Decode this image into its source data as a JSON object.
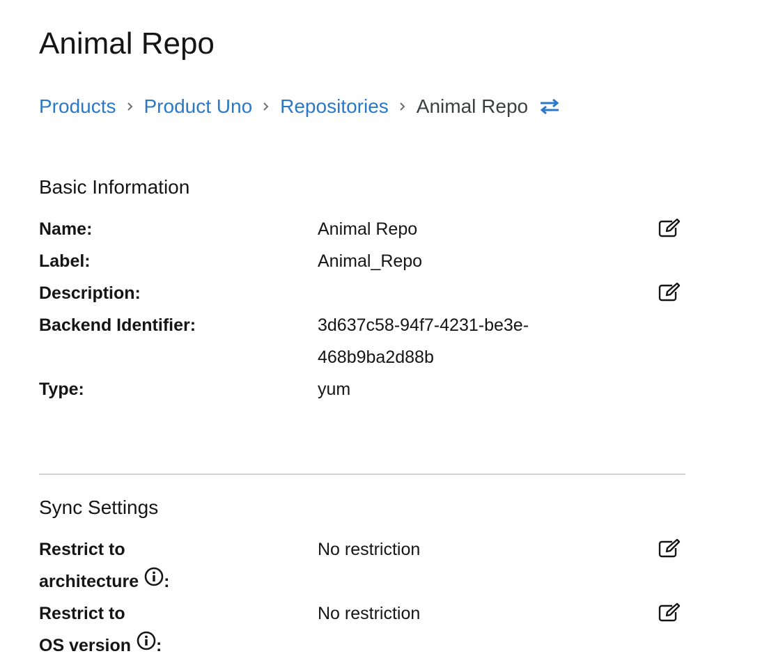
{
  "page_title": "Animal Repo",
  "breadcrumb": {
    "items": [
      "Products",
      "Product Uno",
      "Repositories"
    ],
    "current": "Animal Repo",
    "separator": "›",
    "switcher_icon": "exchange-arrows-icon"
  },
  "basic_info": {
    "title": "Basic Information",
    "name_label": "Name:",
    "name_value": "Animal Repo",
    "label_label": "Label:",
    "label_value": "Animal_Repo",
    "description_label": "Description:",
    "description_value": "",
    "backend_label": "Backend Identifier:",
    "backend_value_line1": "3d637c58-94f7-4231-be3e-",
    "backend_value_line2": "468b9ba2d88b",
    "type_label": "Type:",
    "type_value": "yum"
  },
  "sync_settings": {
    "title": "Sync Settings",
    "arch_label_line1": "Restrict to",
    "arch_label_line2": "architecture",
    "arch_value": "No restriction",
    "os_label_line1": "Restrict to",
    "os_label_line2": "OS version",
    "os_value": "No restriction",
    "label_suffix": ":"
  },
  "icons": {
    "edit": "edit-pencil-icon",
    "info": "info-circle-icon"
  },
  "colors": {
    "link": "#2b78c6",
    "text": "#151515",
    "divider": "#d2d2d2"
  }
}
